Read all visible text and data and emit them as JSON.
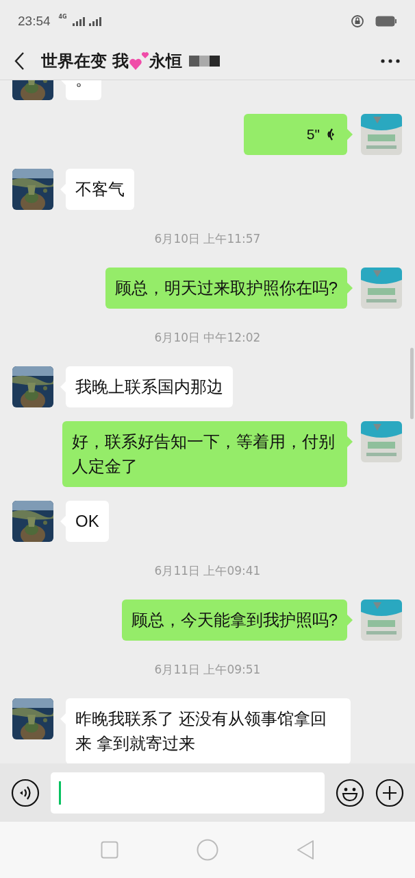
{
  "status_bar": {
    "time": "23:54",
    "network": "4G"
  },
  "header": {
    "title_start": "世界在变 我",
    "title_end": "永恒"
  },
  "messages": [
    {
      "kind": "text",
      "outgoing": false,
      "text": "。"
    },
    {
      "kind": "voice",
      "outgoing": true,
      "text": "5\""
    },
    {
      "kind": "text",
      "outgoing": false,
      "text": "不客气"
    },
    {
      "kind": "time",
      "text": "6月10日 上午11:57"
    },
    {
      "kind": "text",
      "outgoing": true,
      "text": "顾总，明天过来取护照你在吗?"
    },
    {
      "kind": "time",
      "text": "6月10日 中午12:02"
    },
    {
      "kind": "text",
      "outgoing": false,
      "text": "我晚上联系国内那边"
    },
    {
      "kind": "text",
      "outgoing": true,
      "text": "好，联系好告知一下，等着用，付别人定金了"
    },
    {
      "kind": "text",
      "outgoing": false,
      "text": "OK"
    },
    {
      "kind": "time",
      "text": "6月11日 上午09:41"
    },
    {
      "kind": "text",
      "outgoing": true,
      "text": "顾总，今天能拿到我护照吗?"
    },
    {
      "kind": "time",
      "text": "6月11日 上午09:51"
    },
    {
      "kind": "text",
      "outgoing": false,
      "text": "昨晚我联系了 还没有从领事馆拿回来 拿到就寄过来"
    }
  ]
}
